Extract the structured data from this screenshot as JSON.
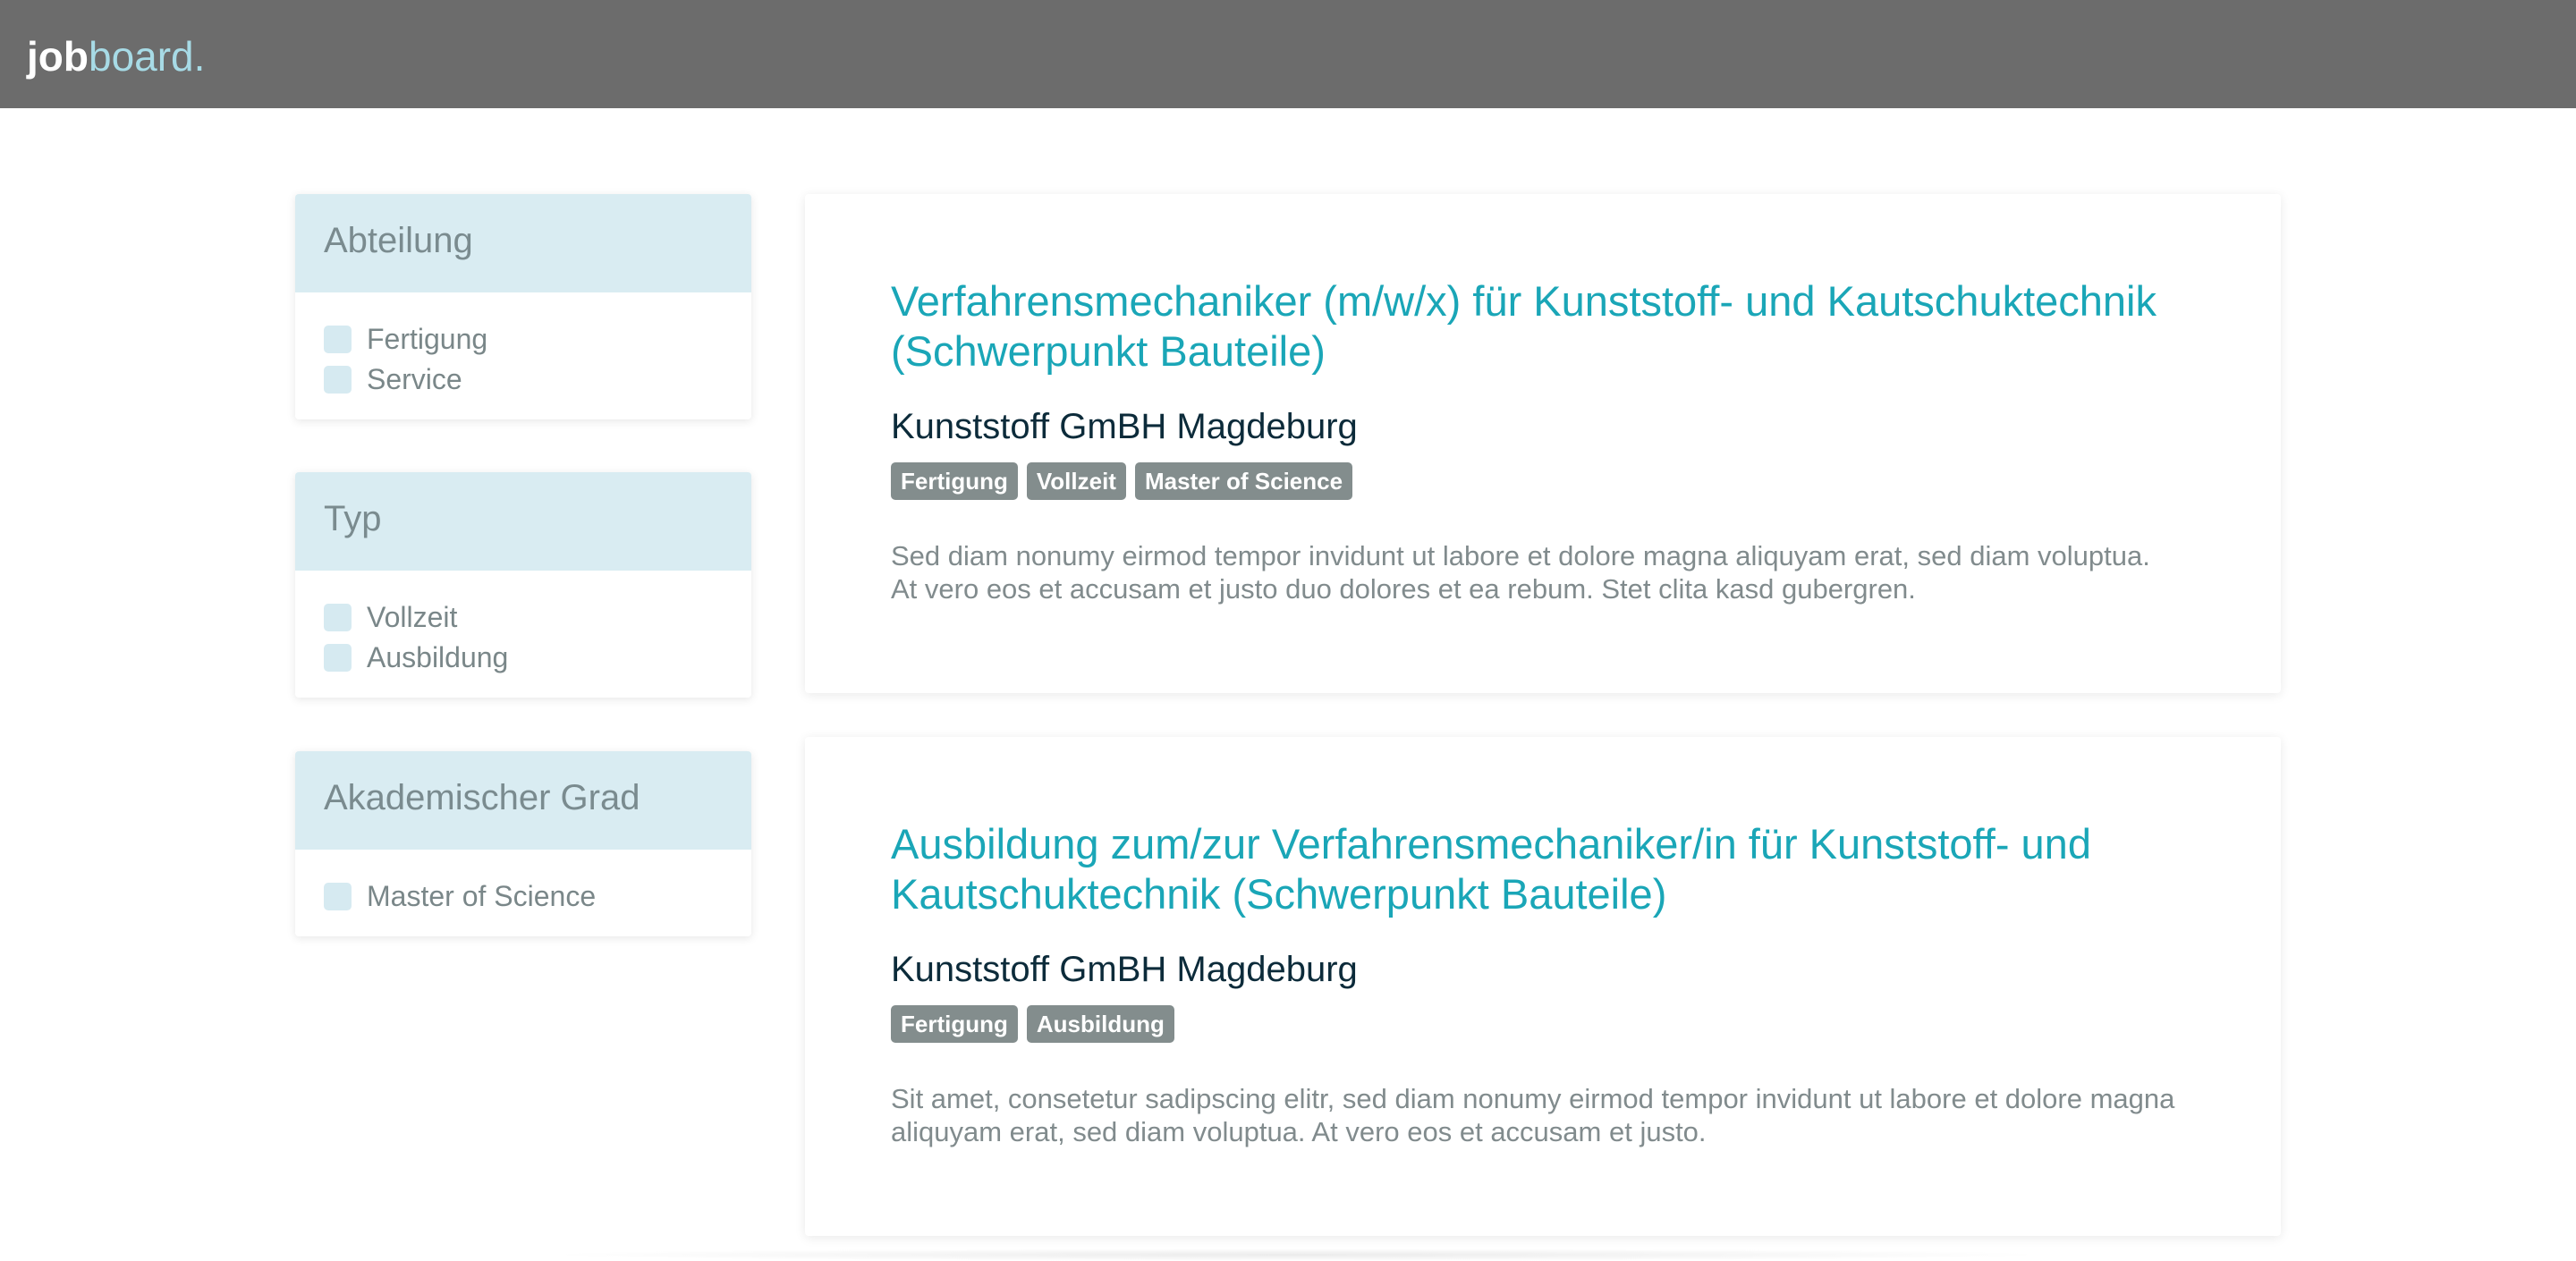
{
  "header": {
    "brand_bold": "job",
    "brand_light": "board."
  },
  "filters": [
    {
      "title": "Abteilung",
      "options": [
        "Fertigung",
        "Service"
      ]
    },
    {
      "title": "Typ",
      "options": [
        "Vollzeit",
        "Ausbildung"
      ]
    },
    {
      "title": "Akademischer Grad",
      "options": [
        "Master of Science"
      ]
    }
  ],
  "jobs": [
    {
      "title": "Verfahrensmechaniker (m/w/x) für Kunststoff- und Kautschuktechnik (Schwerpunkt Bauteile)",
      "company": "Kunststoff GmBH",
      "location": "Magdeburg",
      "tags": [
        "Fertigung",
        "Vollzeit",
        "Master of Science"
      ],
      "description": "Sed diam nonumy eirmod tempor invidunt ut labore et dolore magna aliquyam erat, sed diam voluptua. At vero eos et accusam et justo duo dolores et ea rebum. Stet clita kasd gubergren."
    },
    {
      "title": "Ausbildung zum/zur Verfahrensmechaniker/in für Kunststoff- und Kautschuktechnik (Schwerpunkt Bauteile)",
      "company": "Kunststoff GmBH",
      "location": "Magdeburg",
      "tags": [
        "Fertigung",
        "Ausbildung"
      ],
      "description": "Sit amet, consetetur sadipscing elitr, sed diam nonumy eirmod tempor invidunt ut labore et dolore magna aliquyam erat, sed diam voluptua. At vero eos et accusam et justo."
    }
  ],
  "colors": {
    "header_bg": "#6c6c6c",
    "accent": "#1aa6b7",
    "filter_head_bg": "#d9ecf2",
    "tag_bg": "#838d8d"
  }
}
